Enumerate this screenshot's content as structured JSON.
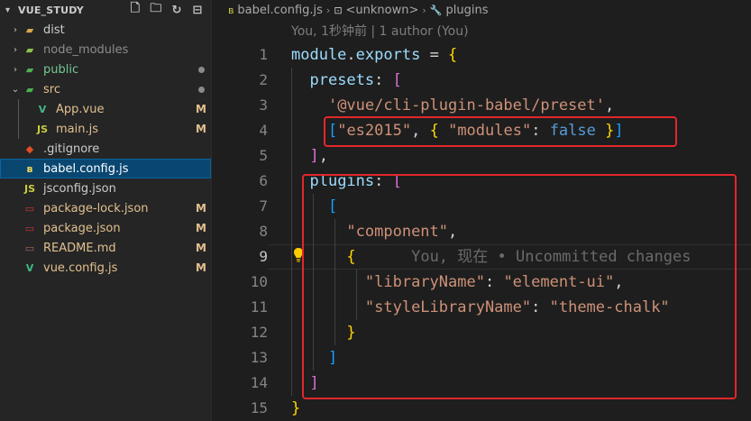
{
  "sidebar": {
    "title": "VUE_STUDY",
    "actions": [
      {
        "icon": "new-file-icon",
        "glyph": "🗋"
      },
      {
        "icon": "new-folder-icon",
        "glyph": "🗀"
      },
      {
        "icon": "refresh-icon",
        "glyph": "↻"
      },
      {
        "icon": "collapse-all-icon",
        "glyph": "⊟"
      }
    ],
    "items": [
      {
        "name": "dist",
        "type": "folder",
        "expanded": false,
        "icon": "folder-dist-icon",
        "color": "#cccccc",
        "status": ""
      },
      {
        "name": "node_modules",
        "type": "folder",
        "expanded": false,
        "icon": "folder-node-icon",
        "color": "#8c8c8c",
        "status": ""
      },
      {
        "name": "public",
        "type": "folder",
        "expanded": false,
        "icon": "folder-public-icon",
        "color": "#73c991",
        "status": "dot"
      },
      {
        "name": "src",
        "type": "folder",
        "expanded": true,
        "icon": "folder-src-icon",
        "color": "#e2c08d",
        "status": "dot"
      },
      {
        "name": "App.vue",
        "type": "file",
        "icon": "vue-file-icon",
        "color": "#e2c08d",
        "status": "M",
        "nested": true
      },
      {
        "name": "main.js",
        "type": "file",
        "icon": "js-file-icon",
        "color": "#e2c08d",
        "status": "M",
        "nested": true
      },
      {
        "name": ".gitignore",
        "type": "file",
        "icon": "git-file-icon",
        "color": "#cccccc",
        "status": ""
      },
      {
        "name": "babel.config.js",
        "type": "file",
        "icon": "babel-file-icon",
        "color": "#ffffff",
        "status": "",
        "selected": true
      },
      {
        "name": "jsconfig.json",
        "type": "file",
        "icon": "js-file-icon",
        "color": "#cccccc",
        "status": ""
      },
      {
        "name": "package-lock.json",
        "type": "file",
        "icon": "npm-file-icon",
        "color": "#e2c08d",
        "status": "M"
      },
      {
        "name": "package.json",
        "type": "file",
        "icon": "npm-file-icon",
        "color": "#e2c08d",
        "status": "M"
      },
      {
        "name": "README.md",
        "type": "file",
        "icon": "readme-file-icon",
        "color": "#e2c08d",
        "status": "M"
      },
      {
        "name": "vue.config.js",
        "type": "file",
        "icon": "vue-file-icon",
        "color": "#e2c08d",
        "status": "M"
      }
    ]
  },
  "editor": {
    "breadcrumb": [
      "babel.config.js",
      "<unknown>",
      "plugins"
    ],
    "blame": "You, 1秒钟前 | 1 author (You)",
    "active_line": 9,
    "lines": [
      {
        "n": "1",
        "tokens": [
          [
            "kw",
            "module"
          ],
          [
            "op",
            "."
          ],
          [
            "kw",
            "exports"
          ],
          [
            "op",
            " = "
          ],
          [
            "br1",
            "{"
          ]
        ]
      },
      {
        "n": "2",
        "tokens": [
          [
            "op",
            "  "
          ],
          [
            "kw",
            "presets"
          ],
          [
            "op",
            ": "
          ],
          [
            "br2",
            "["
          ]
        ]
      },
      {
        "n": "3",
        "tokens": [
          [
            "op",
            "    "
          ],
          [
            "str",
            "'@vue/cli-plugin-babel/preset'"
          ],
          [
            "op",
            ","
          ]
        ]
      },
      {
        "n": "4",
        "tokens": [
          [
            "op",
            "    "
          ],
          [
            "br3",
            "["
          ],
          [
            "str",
            "\"es2015\""
          ],
          [
            "op",
            ", "
          ],
          [
            "br1",
            "{"
          ],
          [
            "op",
            " "
          ],
          [
            "str",
            "\"modules\""
          ],
          [
            "op",
            ": "
          ],
          [
            "bool",
            "false"
          ],
          [
            "op",
            " "
          ],
          [
            "br1",
            "}"
          ],
          [
            "br3",
            "]"
          ]
        ]
      },
      {
        "n": "5",
        "tokens": [
          [
            "op",
            "  "
          ],
          [
            "br2",
            "]"
          ],
          [
            "op",
            ","
          ]
        ]
      },
      {
        "n": "6",
        "tokens": [
          [
            "op",
            "  "
          ],
          [
            "kw",
            "plugins"
          ],
          [
            "op",
            ": "
          ],
          [
            "br2",
            "["
          ]
        ]
      },
      {
        "n": "7",
        "tokens": [
          [
            "op",
            "    "
          ],
          [
            "br3",
            "["
          ]
        ]
      },
      {
        "n": "8",
        "tokens": [
          [
            "op",
            "      "
          ],
          [
            "str",
            "\"component\""
          ],
          [
            "op",
            ","
          ]
        ]
      },
      {
        "n": "9",
        "tokens": [
          [
            "op",
            "      "
          ],
          [
            "br1",
            "{"
          ],
          [
            "op",
            "      "
          ],
          [
            "ghost",
            "You, 现在 • Uncommitted changes"
          ]
        ]
      },
      {
        "n": "10",
        "tokens": [
          [
            "op",
            "        "
          ],
          [
            "str",
            "\"libraryName\""
          ],
          [
            "op",
            ": "
          ],
          [
            "str",
            "\"element-ui\""
          ],
          [
            "op",
            ","
          ]
        ]
      },
      {
        "n": "11",
        "tokens": [
          [
            "op",
            "        "
          ],
          [
            "str",
            "\"styleLibraryName\""
          ],
          [
            "op",
            ": "
          ],
          [
            "str",
            "\"theme-chalk\""
          ]
        ]
      },
      {
        "n": "12",
        "tokens": [
          [
            "op",
            "      "
          ],
          [
            "br1",
            "}"
          ]
        ]
      },
      {
        "n": "13",
        "tokens": [
          [
            "op",
            "    "
          ],
          [
            "br3",
            "]"
          ]
        ]
      },
      {
        "n": "14",
        "tokens": [
          [
            "op",
            "  "
          ],
          [
            "br2",
            "]"
          ]
        ]
      },
      {
        "n": "15",
        "tokens": [
          [
            "br1",
            "}"
          ]
        ]
      }
    ],
    "highlight_color": "#e3262c"
  }
}
